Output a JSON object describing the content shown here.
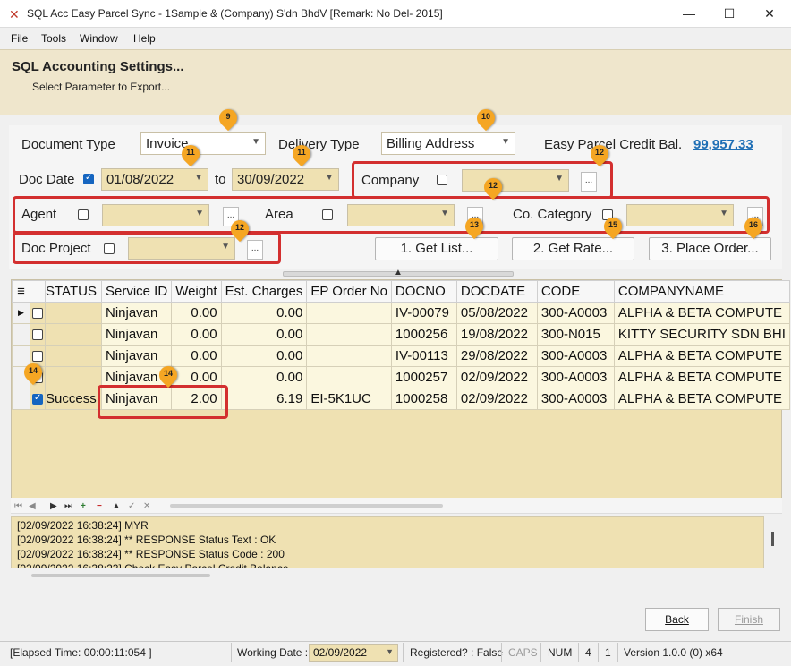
{
  "window": {
    "title": "SQL Acc Easy Parcel Sync - 1Sample & (Company) S'dn BhdV [Remark: No Del- 2015]",
    "minimize": "—",
    "maximize": "☐",
    "close": "✕"
  },
  "menu": [
    "File",
    "Tools",
    "Window",
    "Help"
  ],
  "header": {
    "title": "SQL Accounting Settings...",
    "subtitle": "Select Parameter to Export..."
  },
  "settings": {
    "document_type_label": "Document Type",
    "document_type_value": "Invoice",
    "delivery_type_label": "Delivery Type",
    "delivery_type_value": "Billing Address",
    "credit_label": "Easy Parcel Credit Bal.",
    "credit_value": "99,957.33",
    "doc_date_label": "Doc Date",
    "doc_date_checked": true,
    "date_from": "01/08/2022",
    "to_label": "to",
    "date_to": "30/09/2022",
    "company_label": "Company",
    "agent_label": "Agent",
    "area_label": "Area",
    "category_label": "Co. Category",
    "project_label": "Doc Project",
    "ellipsis": "...",
    "btn_get_list": "1. Get List...",
    "btn_get_rate": "2. Get Rate...",
    "btn_place_order": "3. Place Order..."
  },
  "markers": [
    "9",
    "10",
    "11",
    "11",
    "12",
    "12",
    "12",
    "13",
    "15",
    "16",
    "14",
    "14"
  ],
  "grid": {
    "columns": [
      "STATUS",
      "Service ID",
      "Weight",
      "Est. Charges",
      "EP Order No",
      "DOCNO",
      "DOCDATE",
      "CODE",
      "COMPANYNAME"
    ],
    "rows": [
      {
        "checked": false,
        "current": true,
        "status": "",
        "service": "Ninjavan",
        "weight": "0.00",
        "charges": "0.00",
        "ep_order": "",
        "docno": "IV-00079",
        "docdate": "05/08/2022",
        "code": "300-A0003",
        "company": "ALPHA & BETA COMPUTE"
      },
      {
        "checked": false,
        "current": false,
        "status": "",
        "service": "Ninjavan",
        "weight": "0.00",
        "charges": "0.00",
        "ep_order": "",
        "docno": "1000256",
        "docdate": "19/08/2022",
        "code": "300-N015",
        "company": "KITTY SECURITY SDN BHI"
      },
      {
        "checked": false,
        "current": false,
        "status": "",
        "service": "Ninjavan",
        "weight": "0.00",
        "charges": "0.00",
        "ep_order": "",
        "docno": "IV-00113",
        "docdate": "29/08/2022",
        "code": "300-A0003",
        "company": "ALPHA & BETA COMPUTE"
      },
      {
        "checked": false,
        "current": false,
        "status": "",
        "service": "Ninjavan",
        "weight": "0.00",
        "charges": "0.00",
        "ep_order": "",
        "docno": "1000257",
        "docdate": "02/09/2022",
        "code": "300-A0003",
        "company": "ALPHA & BETA COMPUTE"
      },
      {
        "checked": true,
        "current": false,
        "status": "Success",
        "service": "Ninjavan",
        "weight": "2.00",
        "charges": "6.19",
        "ep_order": "EI-5K1UC",
        "docno": "1000258",
        "docdate": "02/09/2022",
        "code": "300-A0003",
        "company": "ALPHA & BETA COMPUTE"
      }
    ]
  },
  "log": [
    "[02/09/2022 16:38:24] MYR",
    "[02/09/2022 16:38:24] ** RESPONSE Status Text : OK",
    "[02/09/2022 16:38:24] ** RESPONSE Status Code : 200",
    "[02/09/2022 16:38:23] Check Easy Parcel Credit Balance"
  ],
  "footer": {
    "back": "Back",
    "finish": "Finish"
  },
  "status": {
    "elapsed": "[Elapsed Time: 00:00:11:054 ]",
    "working_date_label": "Working Date :",
    "working_date": "02/09/2022",
    "registered": "Registered? : False",
    "caps": "CAPS",
    "num": "NUM",
    "n1": "4",
    "n2": "1",
    "version": "Version 1.0.0 (0) x64"
  },
  "colors": {
    "accent_red": "#d32f2f",
    "marker": "#f5a623",
    "link": "#1f6fb5",
    "field": "#efe1b2"
  }
}
